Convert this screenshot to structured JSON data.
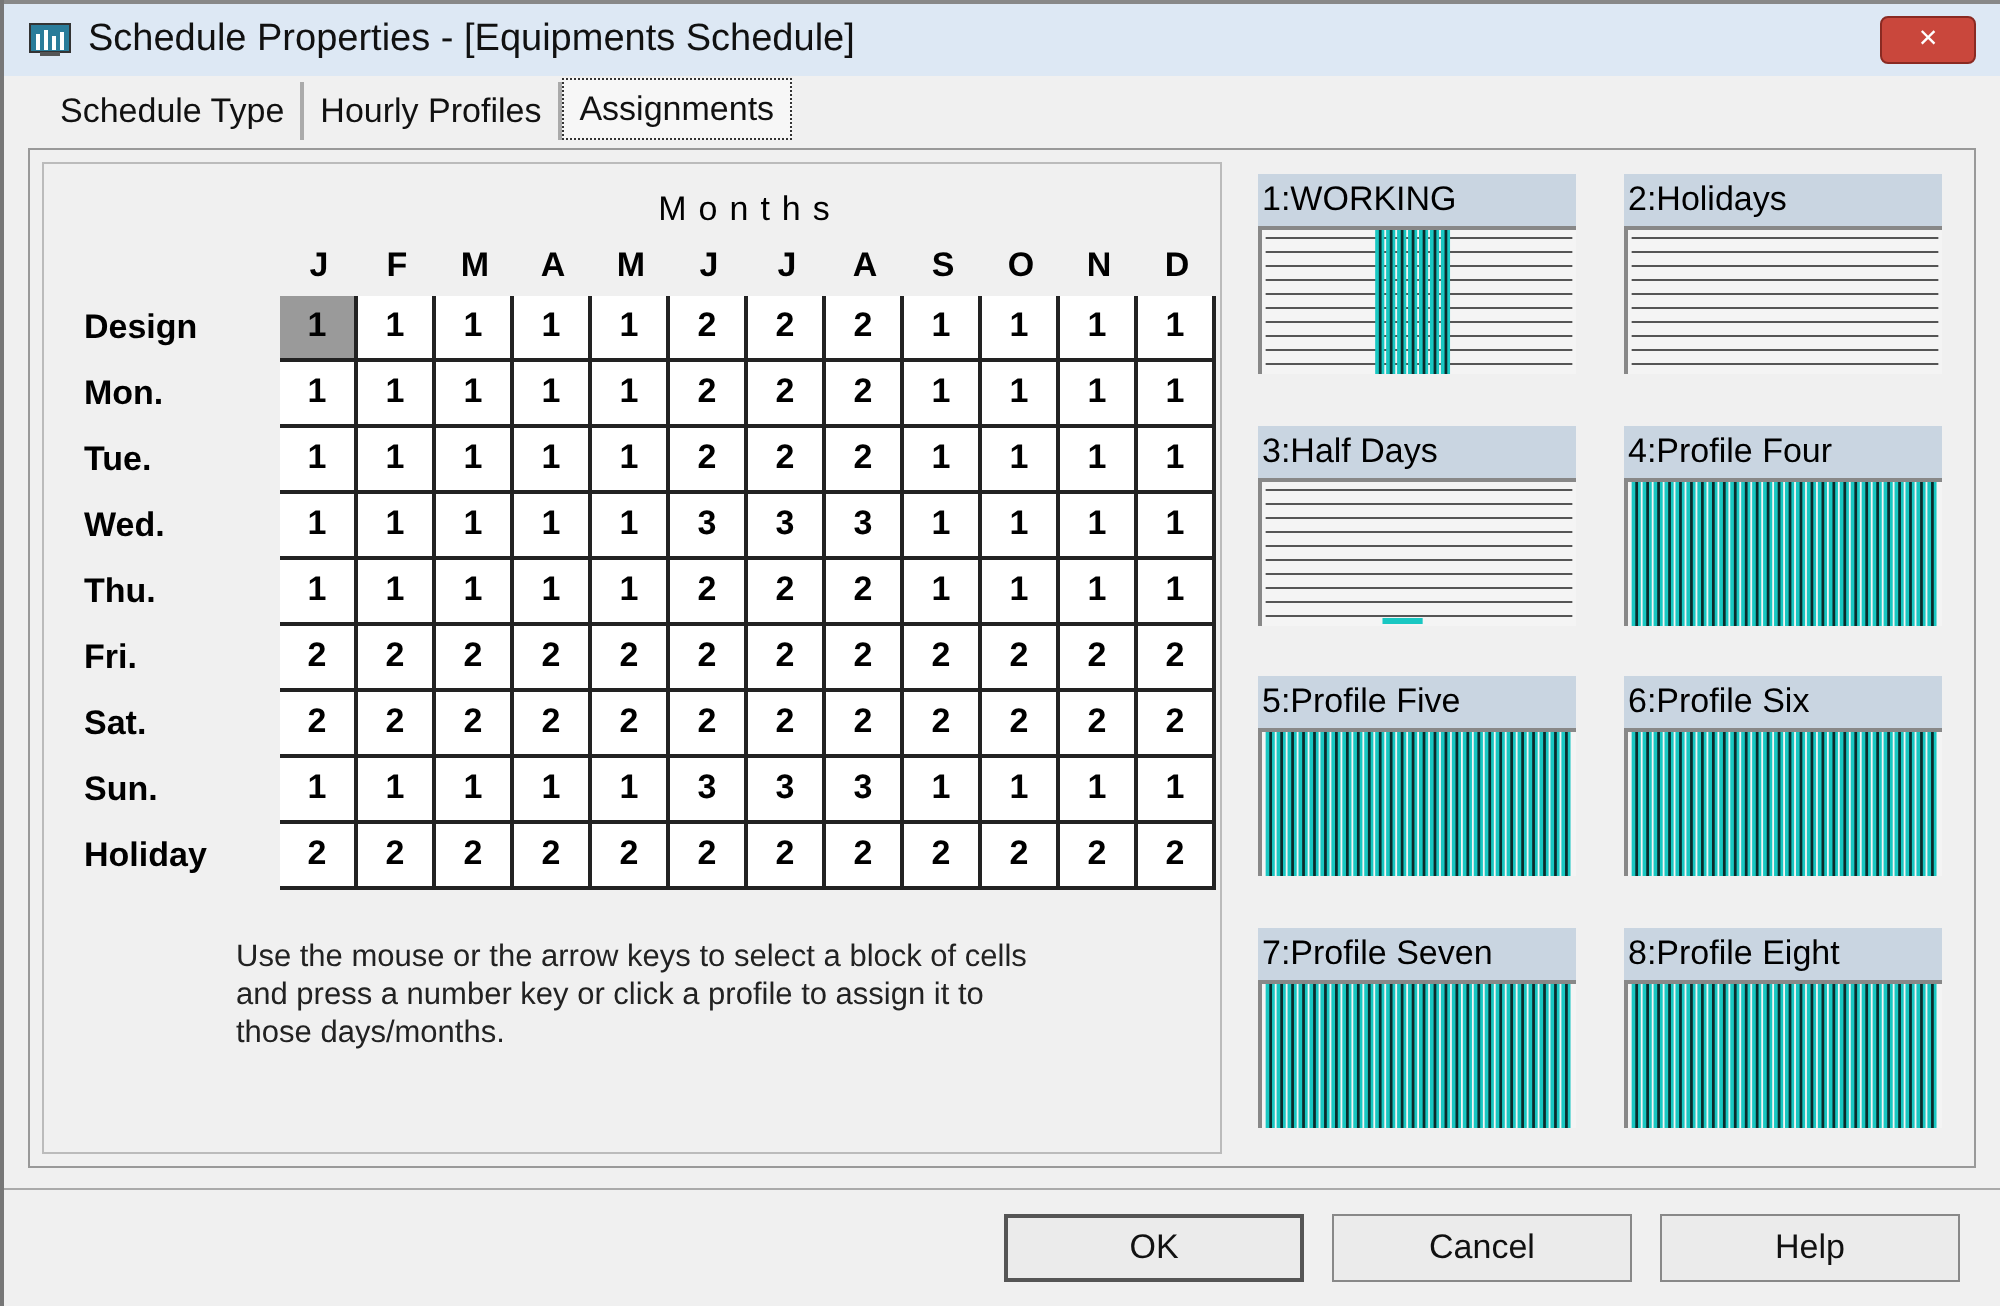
{
  "window": {
    "title": "Schedule Properties - [Equipments Schedule]",
    "close": "×"
  },
  "tabs": [
    {
      "label": "Schedule Type",
      "selected": false
    },
    {
      "label": "Hourly Profiles",
      "selected": false
    },
    {
      "label": "Assignments",
      "selected": true
    }
  ],
  "grid": {
    "title": "Months",
    "months": [
      "J",
      "F",
      "M",
      "A",
      "M",
      "J",
      "J",
      "A",
      "S",
      "O",
      "N",
      "D"
    ],
    "rows": [
      {
        "label": "Design",
        "cells": [
          {
            "value": "1",
            "selected": true
          },
          {
            "value": "1",
            "selected": false
          },
          {
            "value": "1",
            "selected": false
          },
          {
            "value": "1",
            "selected": false
          },
          {
            "value": "1",
            "selected": false
          },
          {
            "value": "2",
            "selected": false
          },
          {
            "value": "2",
            "selected": false
          },
          {
            "value": "2",
            "selected": false
          },
          {
            "value": "1",
            "selected": false
          },
          {
            "value": "1",
            "selected": false
          },
          {
            "value": "1",
            "selected": false
          },
          {
            "value": "1",
            "selected": false
          }
        ]
      },
      {
        "label": "Mon.",
        "cells": [
          {
            "value": "1",
            "selected": false
          },
          {
            "value": "1",
            "selected": false
          },
          {
            "value": "1",
            "selected": false
          },
          {
            "value": "1",
            "selected": false
          },
          {
            "value": "1",
            "selected": false
          },
          {
            "value": "2",
            "selected": false
          },
          {
            "value": "2",
            "selected": false
          },
          {
            "value": "2",
            "selected": false
          },
          {
            "value": "1",
            "selected": false
          },
          {
            "value": "1",
            "selected": false
          },
          {
            "value": "1",
            "selected": false
          },
          {
            "value": "1",
            "selected": false
          }
        ]
      },
      {
        "label": "Tue.",
        "cells": [
          {
            "value": "1",
            "selected": false
          },
          {
            "value": "1",
            "selected": false
          },
          {
            "value": "1",
            "selected": false
          },
          {
            "value": "1",
            "selected": false
          },
          {
            "value": "1",
            "selected": false
          },
          {
            "value": "2",
            "selected": false
          },
          {
            "value": "2",
            "selected": false
          },
          {
            "value": "2",
            "selected": false
          },
          {
            "value": "1",
            "selected": false
          },
          {
            "value": "1",
            "selected": false
          },
          {
            "value": "1",
            "selected": false
          },
          {
            "value": "1",
            "selected": false
          }
        ]
      },
      {
        "label": "Wed.",
        "cells": [
          {
            "value": "1",
            "selected": false
          },
          {
            "value": "1",
            "selected": false
          },
          {
            "value": "1",
            "selected": false
          },
          {
            "value": "1",
            "selected": false
          },
          {
            "value": "1",
            "selected": false
          },
          {
            "value": "3",
            "selected": false
          },
          {
            "value": "3",
            "selected": false
          },
          {
            "value": "3",
            "selected": false
          },
          {
            "value": "1",
            "selected": false
          },
          {
            "value": "1",
            "selected": false
          },
          {
            "value": "1",
            "selected": false
          },
          {
            "value": "1",
            "selected": false
          }
        ]
      },
      {
        "label": "Thu.",
        "cells": [
          {
            "value": "1",
            "selected": false
          },
          {
            "value": "1",
            "selected": false
          },
          {
            "value": "1",
            "selected": false
          },
          {
            "value": "1",
            "selected": false
          },
          {
            "value": "1",
            "selected": false
          },
          {
            "value": "2",
            "selected": false
          },
          {
            "value": "2",
            "selected": false
          },
          {
            "value": "2",
            "selected": false
          },
          {
            "value": "1",
            "selected": false
          },
          {
            "value": "1",
            "selected": false
          },
          {
            "value": "1",
            "selected": false
          },
          {
            "value": "1",
            "selected": false
          }
        ]
      },
      {
        "label": "Fri.",
        "cells": [
          {
            "value": "2",
            "selected": false
          },
          {
            "value": "2",
            "selected": false
          },
          {
            "value": "2",
            "selected": false
          },
          {
            "value": "2",
            "selected": false
          },
          {
            "value": "2",
            "selected": false
          },
          {
            "value": "2",
            "selected": false
          },
          {
            "value": "2",
            "selected": false
          },
          {
            "value": "2",
            "selected": false
          },
          {
            "value": "2",
            "selected": false
          },
          {
            "value": "2",
            "selected": false
          },
          {
            "value": "2",
            "selected": false
          },
          {
            "value": "2",
            "selected": false
          }
        ]
      },
      {
        "label": "Sat.",
        "cells": [
          {
            "value": "2",
            "selected": false
          },
          {
            "value": "2",
            "selected": false
          },
          {
            "value": "2",
            "selected": false
          },
          {
            "value": "2",
            "selected": false
          },
          {
            "value": "2",
            "selected": false
          },
          {
            "value": "2",
            "selected": false
          },
          {
            "value": "2",
            "selected": false
          },
          {
            "value": "2",
            "selected": false
          },
          {
            "value": "2",
            "selected": false
          },
          {
            "value": "2",
            "selected": false
          },
          {
            "value": "2",
            "selected": false
          },
          {
            "value": "2",
            "selected": false
          }
        ]
      },
      {
        "label": "Sun.",
        "cells": [
          {
            "value": "1",
            "selected": false
          },
          {
            "value": "1",
            "selected": false
          },
          {
            "value": "1",
            "selected": false
          },
          {
            "value": "1",
            "selected": false
          },
          {
            "value": "1",
            "selected": false
          },
          {
            "value": "3",
            "selected": false
          },
          {
            "value": "3",
            "selected": false
          },
          {
            "value": "3",
            "selected": false
          },
          {
            "value": "1",
            "selected": false
          },
          {
            "value": "1",
            "selected": false
          },
          {
            "value": "1",
            "selected": false
          },
          {
            "value": "1",
            "selected": false
          }
        ]
      },
      {
        "label": "Holiday",
        "cells": [
          {
            "value": "2",
            "selected": false
          },
          {
            "value": "2",
            "selected": false
          },
          {
            "value": "2",
            "selected": false
          },
          {
            "value": "2",
            "selected": false
          },
          {
            "value": "2",
            "selected": false
          },
          {
            "value": "2",
            "selected": false
          },
          {
            "value": "2",
            "selected": false
          },
          {
            "value": "2",
            "selected": false
          },
          {
            "value": "2",
            "selected": false
          },
          {
            "value": "2",
            "selected": false
          },
          {
            "value": "2",
            "selected": false
          },
          {
            "value": "2",
            "selected": false
          }
        ]
      }
    ]
  },
  "hint": "Use the mouse or the arrow keys to select a block of cells and press a number key or click a profile to assign it to those days/months.",
  "profiles": [
    {
      "label": "1:WORKING",
      "kind": "day_block"
    },
    {
      "label": "2:Holidays",
      "kind": "empty"
    },
    {
      "label": "3:Half Days",
      "kind": "dots"
    },
    {
      "label": "4:Profile Four",
      "kind": "full"
    },
    {
      "label": "5:Profile Five",
      "kind": "full"
    },
    {
      "label": "6:Profile Six",
      "kind": "full"
    },
    {
      "label": "7:Profile Seven",
      "kind": "full"
    },
    {
      "label": "8:Profile Eight",
      "kind": "full"
    }
  ],
  "buttons": [
    {
      "label": "OK",
      "default": true
    },
    {
      "label": "Cancel",
      "default": false
    },
    {
      "label": "Help",
      "default": false
    }
  ]
}
